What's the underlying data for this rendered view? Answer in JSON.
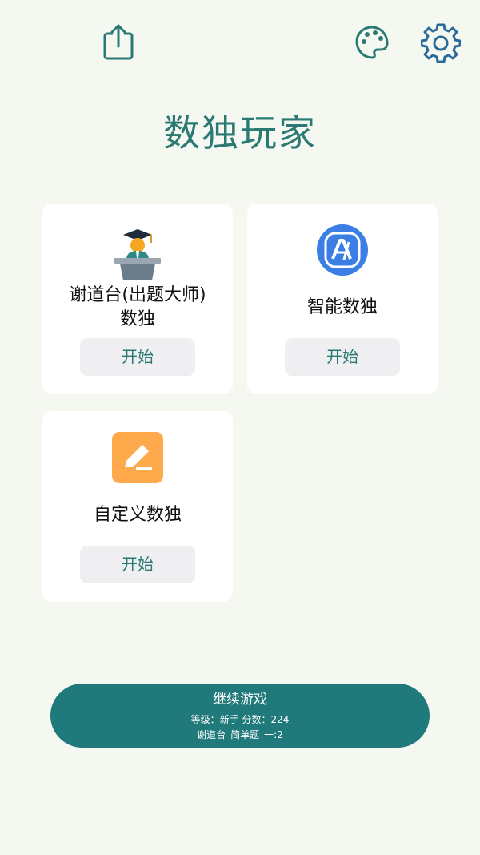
{
  "toolbar": {
    "share_icon": "share-icon",
    "palette_icon": "palette-icon",
    "settings_icon": "gear-icon"
  },
  "app_title": "数独玩家",
  "cards": [
    {
      "icon": "teacher-podium-icon",
      "title_line1": "谢道台(出题大师)",
      "title_line2": "数独",
      "start_label": "开始"
    },
    {
      "icon": "ai-icon",
      "title_line1": "智能数独",
      "start_label": "开始"
    },
    {
      "icon": "edit-icon",
      "title_line1": "自定义数独",
      "start_label": "开始"
    }
  ],
  "continue": {
    "label": "继续游戏",
    "level_label": "等级：",
    "level_value": "新手",
    "score_label": "分数：",
    "score_value": "224",
    "puzzle_info": "谢道台_简单题_一:2"
  },
  "colors": {
    "background": "#f5f8f1",
    "accent": "#2a7a73",
    "button_bg": "#efeff2",
    "continue_bg": "#20797a",
    "ai_icon_bg": "#3b82f6",
    "edit_icon_bg": "#ffa94d"
  }
}
